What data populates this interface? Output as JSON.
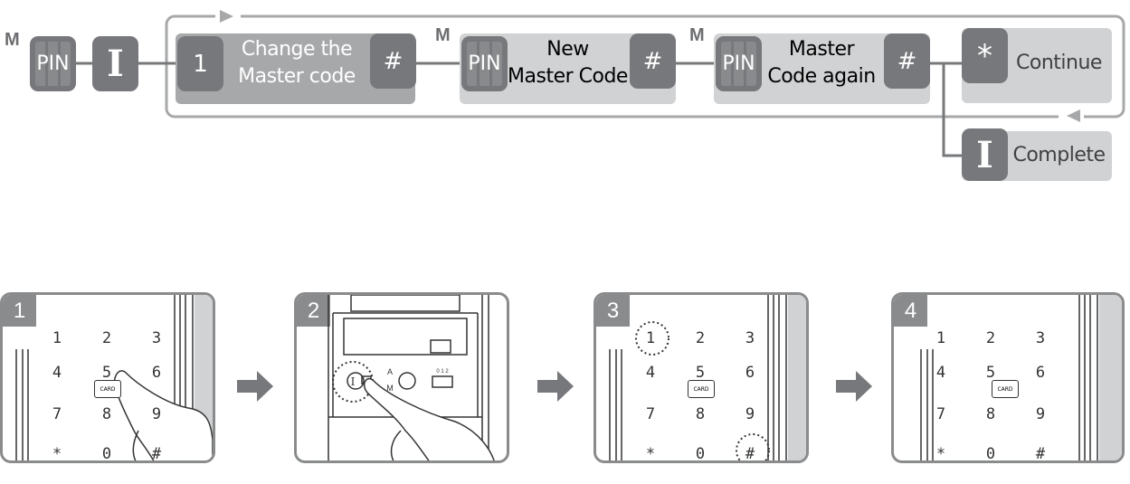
{
  "flow": {
    "m_label": "M",
    "pin_label": "PIN",
    "i_label": "I",
    "step1": {
      "key": "1",
      "text_line1": "Change the",
      "text_line2": "Master code",
      "end_key": "#"
    },
    "step2": {
      "m_label": "M",
      "key": "PIN",
      "text_line1": "New",
      "text_line2": "Master Code",
      "end_key": "#"
    },
    "step3": {
      "m_label": "M",
      "key": "PIN",
      "text_line1": "Master",
      "text_line2": "Code again",
      "end_key": "#"
    },
    "step4": {
      "key": "*",
      "text": "Continue"
    },
    "complete": {
      "key": "I",
      "text": "Complete"
    }
  },
  "panels": [
    {
      "number": "1",
      "card_label": "CARD"
    },
    {
      "number": "2",
      "switch_labels": "0 1 2",
      "mode_top": "A",
      "mode_bottom": "M"
    },
    {
      "number": "3",
      "card_label": "CARD"
    },
    {
      "number": "4",
      "card_label": "CARD"
    }
  ],
  "keypad": [
    "1",
    "2",
    "3",
    "4",
    "5",
    "6",
    "7",
    "8",
    "9",
    "*",
    "0",
    "#"
  ],
  "colors": {
    "dark_key": "#77787b",
    "dark_box": "#a7a8aa",
    "light_box": "#d1d2d4",
    "border": "#8a8b8d"
  }
}
